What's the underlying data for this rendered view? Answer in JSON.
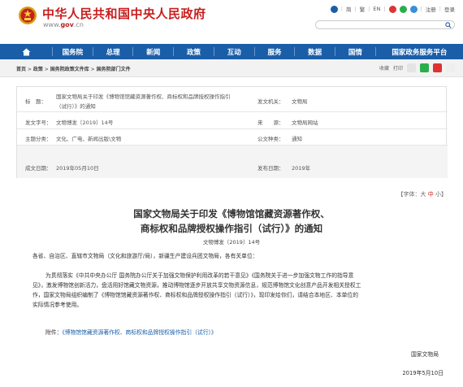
{
  "header": {
    "site_title": "中华人民共和国中央人民政府",
    "site_url_prefix": "www.",
    "site_url_gov": "gov",
    "site_url_suffix": ".cn",
    "links": {
      "simplified": "简",
      "traditional": "繁",
      "english": "EN",
      "register": "注册",
      "login": "登录"
    },
    "search_placeholder": ""
  },
  "nav": {
    "home_icon": "home-icon",
    "items": [
      "国务院",
      "总理",
      "新闻",
      "政策",
      "互动",
      "服务",
      "数据",
      "国情",
      "国家政务服务平台"
    ]
  },
  "breadcrumb": {
    "home": "首页",
    "sep1": " > ",
    "policies": "政策",
    "sep2": " > ",
    "library": "国务院政策文件库",
    "sep3": " > ",
    "dept": "国务院部门文件"
  },
  "tools": {
    "favorite": "收藏",
    "print": "打印"
  },
  "info": {
    "title_label": "标　题：",
    "title_line1": "国家文物局关于印发《博物馆馆藏资源著作权、商标权和品牌授权操作指引",
    "title_line2": "（试行）》的通知",
    "issuer_label": "发文机关：",
    "issuer": "文物局",
    "docno_label": "发文字号：",
    "docno": "文物博发〔2019〕14号",
    "source_label": "来　　源：",
    "source": "文物局网站",
    "topic_label": "主题分类：",
    "topic": "文化、广电、新闻出版\\文物",
    "type_label": "公文种类：",
    "type": "通知",
    "date_label": "成文日期：",
    "date": "2019年05月10日",
    "pub_label": "发布日期：",
    "pub": "2019年"
  },
  "fontsize": {
    "prefix": "【字体：",
    "big": "大",
    "mid": "中",
    "small": "小",
    "suffix": "】"
  },
  "article": {
    "title_line1": "国家文物局关于印发《博物馆馆藏资源著作权、",
    "title_line2": "商标权和品牌授权操作指引（试行）》的通知",
    "doc_no": "文物博发〔2019〕14号",
    "recipients": "各省、自治区、直辖市文物局（文化和旅游厅/局），新疆生产建设兵团文物局，各有关单位：",
    "body_l1": "为贯彻落实《中共中央办公厅 国务院办公厅关于加强文物保护利用改革的若干意见》《国务院关于进一步加强文物工作的指导意",
    "body_l2": "见》，激发博物馆创新活力，盘活用好馆藏文物资源，推动博物馆逐步开放共享文物资源信息，规范博物馆文化创意产品开发相关授权工",
    "body_l3": "作，国家文物局组织编制了《博物馆馆藏资源著作权、商标权和品牌授权操作指引（试行）》，现印发给你们，请结合本地区、本单位的",
    "body_l4": "实际情况参考使用。",
    "attach_label": "附件：",
    "attach_link": "《博物馆馆藏资源著作权、商标权和品牌授权操作指引（试行）》",
    "signer": "国家文物局",
    "sign_date": "2019年5月10日"
  },
  "colors": {
    "brand_red": "#c81e1e",
    "nav_blue": "#1a5ea8"
  }
}
